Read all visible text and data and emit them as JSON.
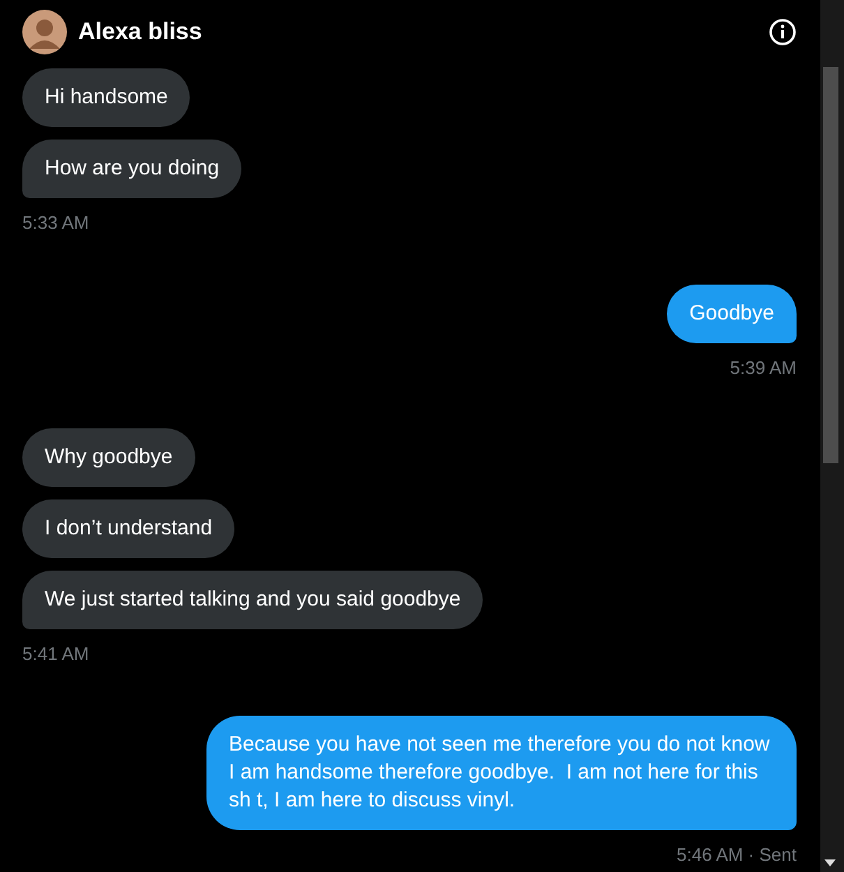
{
  "header": {
    "name": "Alexa bliss"
  },
  "groups": [
    {
      "kind": "received",
      "messages": [
        "Hi handsome",
        "How are you doing"
      ],
      "time": "5:33 AM"
    },
    {
      "kind": "sent",
      "messages": [
        "Goodbye"
      ],
      "time": "5:39 AM"
    },
    {
      "kind": "received",
      "messages": [
        "Why goodbye",
        "I don’t understand",
        "We just started talking and you said goodbye"
      ],
      "time": "5:41 AM"
    },
    {
      "kind": "sent",
      "messages": [
        "Because you have not seen me therefore you do not know I am handsome therefore goodbye.  I am not here for this sh t, I am here to discuss vinyl."
      ],
      "time": "5:46 AM · Sent"
    }
  ]
}
